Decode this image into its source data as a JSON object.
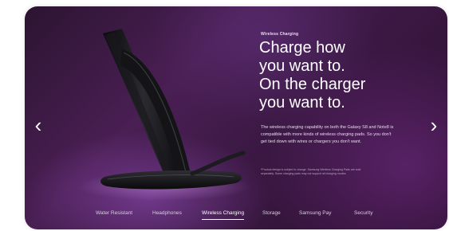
{
  "hero": {
    "eyebrow": "Wireless Charging",
    "headline": [
      "Charge how",
      "you want to.",
      "On the charger",
      "you want to."
    ],
    "body": "The wireless charging capability on both the Galaxy S8 and Note8 is compatible with more kinds of wireless charging pads. So you don't get tied down with wires or chargers you don't want.",
    "disclaimer": "*Product design is subject to change. Samsung Wireless Charging Pads are sold separately. Some charging pads may not support all charging modes."
  },
  "nav": {
    "prev_icon": "chevron-left-icon",
    "next_icon": "chevron-right-icon",
    "prev_glyph": "‹",
    "next_glyph": "›"
  },
  "tabs": [
    {
      "label": "Water Resistant",
      "active": false
    },
    {
      "label": "Headphones",
      "active": false
    },
    {
      "label": "Wireless Charging",
      "active": true
    },
    {
      "label": "Storage",
      "active": false
    },
    {
      "label": "Samsung Pay",
      "active": false
    },
    {
      "label": "Security",
      "active": false
    }
  ],
  "colors": {
    "background_start": "#2c1431",
    "background_mid": "#4a1f54",
    "text": "#ffffff",
    "active_tab_underline": "#ffffff"
  }
}
